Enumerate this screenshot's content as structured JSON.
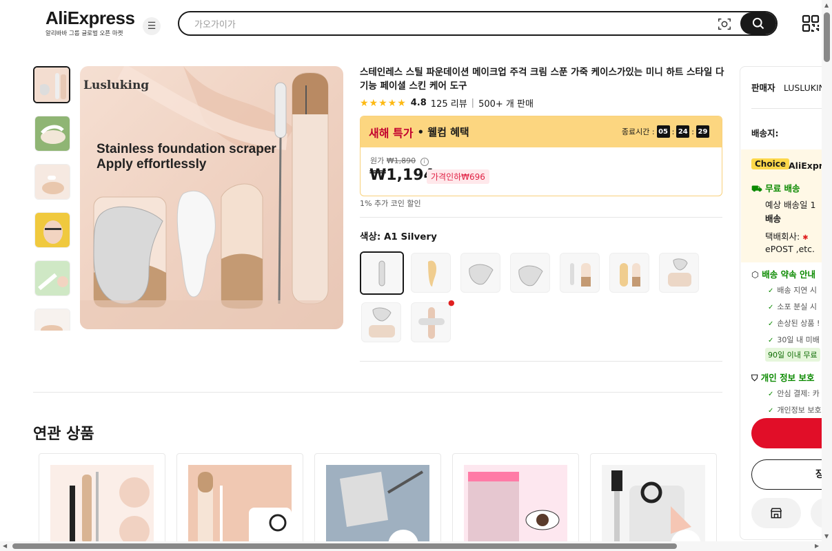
{
  "header": {
    "logo": "AliExpress",
    "logo_sub": "알리바바 그룹 글로벌 오픈 마켓",
    "search_placeholder": "가오가이가"
  },
  "gallery": {
    "brand": "Lusluking",
    "hero_line1": "Stainless foundation scraper",
    "hero_line2": "Apply effortlessly"
  },
  "product": {
    "title": "스테인레스 스틸 파운데이션 메이크업 주걱 크림 스푼 가죽 케이스가있는 미니 하트 스타일 다기능 페이셜 스킨 케어 도구",
    "stars": "★★★★★",
    "rating": "4.8",
    "reviews": "125 리뷰",
    "sold": "500+ 개 판매",
    "promo_title": "새해 특가",
    "promo_sub": "• 웰컴 혜택",
    "timer_label": "종료시간 :",
    "timer_h": "05",
    "timer_m": "24",
    "timer_s": "29",
    "orig_label": "원가",
    "orig_price": "₩1,890",
    "price": "₩1,194",
    "discount": "가격인하₩696",
    "coins": "1% 추가 코인 할인",
    "color_label": "색상:",
    "color_value": "A1 Silvery"
  },
  "related": {
    "title": "연관 상품"
  },
  "sidebar": {
    "seller_label": "판매자",
    "seller_name": "LUSLUKING",
    "ship_to_label": "배송지:",
    "choice_badge": "Choice",
    "choice_text": "AliExpress",
    "free_ship": "무료 배송",
    "est_line1": "예상 배송일 1",
    "est_line2": "배송",
    "courier_label": "택배회사:",
    "courier_line2": "ePOST ,etc.",
    "promise_title": "배송 약속 안내",
    "promise_items": [
      "배송 지연 시",
      "소포 분실 시",
      "손상된 상품 !",
      "30일 내 미배"
    ],
    "promise_tag": "90일 이내 무료",
    "privacy_title": "개인 정보 보호",
    "privacy_items": [
      "안심 결제: 카",
      "개인정보 보호"
    ],
    "cart_label": "장"
  },
  "colors": {
    "accent_red": "#e10e28",
    "promo_yellow": "#fcd680",
    "green": "#0b8a00"
  }
}
